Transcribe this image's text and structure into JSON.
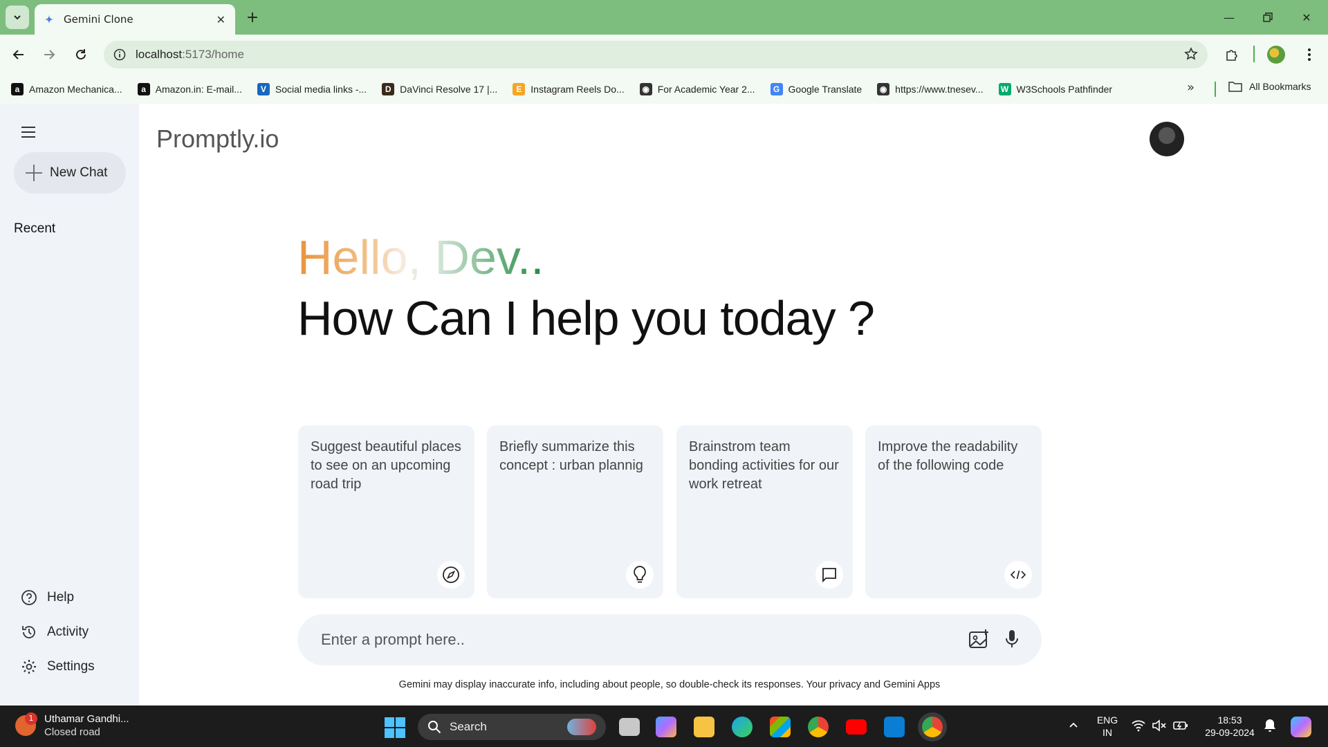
{
  "browser": {
    "tab_title": "Gemini Clone",
    "url_host": "localhost",
    "url_path": ":5173/home",
    "bookmarks": [
      {
        "label": "Amazon Mechanica...",
        "icon": "amazon-icon",
        "color": "#111111",
        "glyph": "a"
      },
      {
        "label": "Amazon.in: E-mail...",
        "icon": "amazon-icon",
        "color": "#111111",
        "glyph": "a"
      },
      {
        "label": "Social media links -...",
        "icon": "vuetify-icon",
        "color": "#1867c0",
        "glyph": "V"
      },
      {
        "label": "DaVinci Resolve 17 |...",
        "icon": "davinci-icon",
        "color": "#3a2a1a",
        "glyph": "D"
      },
      {
        "label": "Instagram Reels Do...",
        "icon": "instagram-e-icon",
        "color": "#f5a623",
        "glyph": "E"
      },
      {
        "label": "For Academic Year 2...",
        "icon": "globe-icon",
        "color": "#333333",
        "glyph": "◉"
      },
      {
        "label": "Google Translate",
        "icon": "google-translate-icon",
        "color": "#4285f4",
        "glyph": "G"
      },
      {
        "label": "https://www.tnesev...",
        "icon": "globe-icon",
        "color": "#333333",
        "glyph": "◉"
      },
      {
        "label": "W3Schools Pathfinder",
        "icon": "w3schools-icon",
        "color": "#04aa6d",
        "glyph": "W"
      }
    ],
    "all_bookmarks": "All Bookmarks"
  },
  "app": {
    "brand": "Promptly.io",
    "new_chat": "New Chat",
    "recent": "Recent",
    "bottom_items": {
      "help": "Help",
      "activity": "Activity",
      "settings": "Settings"
    },
    "greeting": "Hello, Dev..",
    "subtitle": "How Can I help you today ?",
    "cards": [
      {
        "text": "Suggest beautiful places to see on an upcoming road trip",
        "icon": "compass-icon"
      },
      {
        "text": "Briefly summarize this concept : urban plannig",
        "icon": "lightbulb-icon"
      },
      {
        "text": "Brainstrom team bonding activities for our work retreat",
        "icon": "message-icon"
      },
      {
        "text": "Improve the readability of the following code",
        "icon": "code-icon"
      }
    ],
    "prompt_placeholder": "Enter a prompt here..",
    "disclaimer": "Gemini may display inaccurate info, including about people, so double-check its responses. Your privacy and Gemini Apps"
  },
  "taskbar": {
    "weather_title": "Uthamar Gandhi...",
    "weather_sub": "Closed road",
    "weather_badge": "1",
    "search_label": "Search",
    "lang_top": "ENG",
    "lang_bottom": "IN",
    "time": "18:53",
    "date": "29-09-2024"
  },
  "colors": {
    "chrome_green": "#7dbd7d",
    "sidebar_bg": "#f0f4f9",
    "greeting_start": "#e8933a",
    "greeting_end": "#1f8a3e"
  }
}
